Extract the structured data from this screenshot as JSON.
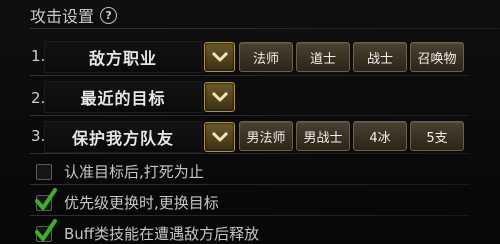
{
  "header": {
    "title": "攻击设置",
    "help_glyph": "?"
  },
  "rows": [
    {
      "num": "1.",
      "field": "敌方职业",
      "options": [
        "法师",
        "道士",
        "战士",
        "召唤物"
      ]
    },
    {
      "num": "2.",
      "field": "最近的目标"
    },
    {
      "num": "3.",
      "field": "保护我方队友",
      "options": [
        "男法师",
        "男战士",
        "4冰",
        "5支"
      ]
    }
  ],
  "checkboxes": [
    {
      "label": "认准目标后,打死为止",
      "checked": false
    },
    {
      "label": "优先级更换时,更换目标",
      "checked": true
    },
    {
      "label": "Buff类技能在遭遇敌方后释放",
      "checked": true
    }
  ],
  "colors": {
    "accent_gold": "#a89050",
    "check_green": "#3fae2a"
  },
  "icons": {
    "dropdown": "chevron-down-icon",
    "check": "checkmark-icon",
    "help": "question-circle-icon"
  }
}
